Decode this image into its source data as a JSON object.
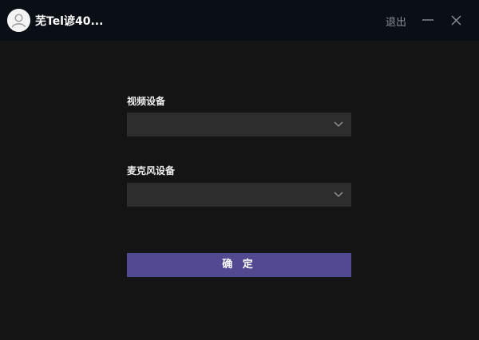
{
  "titlebar": {
    "user_name": "芜Tel谚40...",
    "logout_label": "退出",
    "minimize_icon": "minimize-icon",
    "close_icon": "close-icon",
    "avatar_icon": "user-avatar-icon"
  },
  "form": {
    "video_device_label": "视频设备",
    "video_device_value": "",
    "mic_device_label": "麦克风设备",
    "mic_device_value": "",
    "dropdown_icon": "chevron-down-icon",
    "confirm_label": "确 定"
  },
  "colors": {
    "background": "#141414",
    "titlebar": "#0a0f16",
    "select_bg": "#2d2d2d",
    "accent": "#524a91",
    "muted_text": "#8b8f96"
  }
}
